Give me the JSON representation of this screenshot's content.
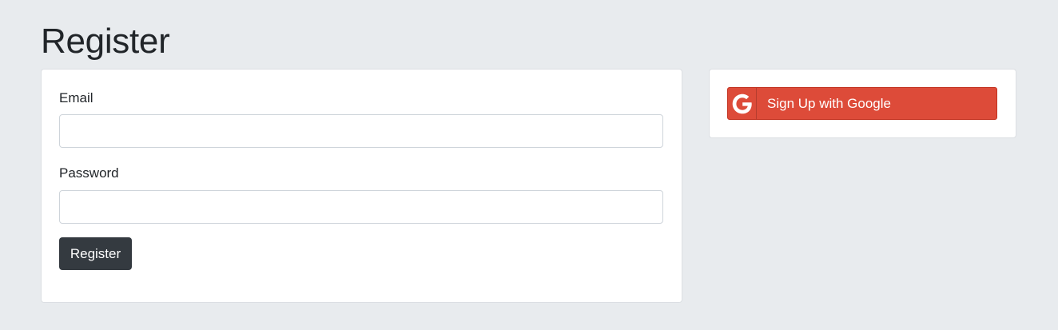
{
  "page": {
    "title": "Register"
  },
  "form": {
    "email": {
      "label": "Email",
      "value": "",
      "placeholder": ""
    },
    "password": {
      "label": "Password",
      "value": "",
      "placeholder": ""
    },
    "submit_label": "Register"
  },
  "social": {
    "google_label": "Sign Up with Google",
    "icon": "google-g-icon"
  },
  "colors": {
    "background": "#e8ebee",
    "register_button": "#343a40",
    "google_button": "#dd4b39"
  }
}
